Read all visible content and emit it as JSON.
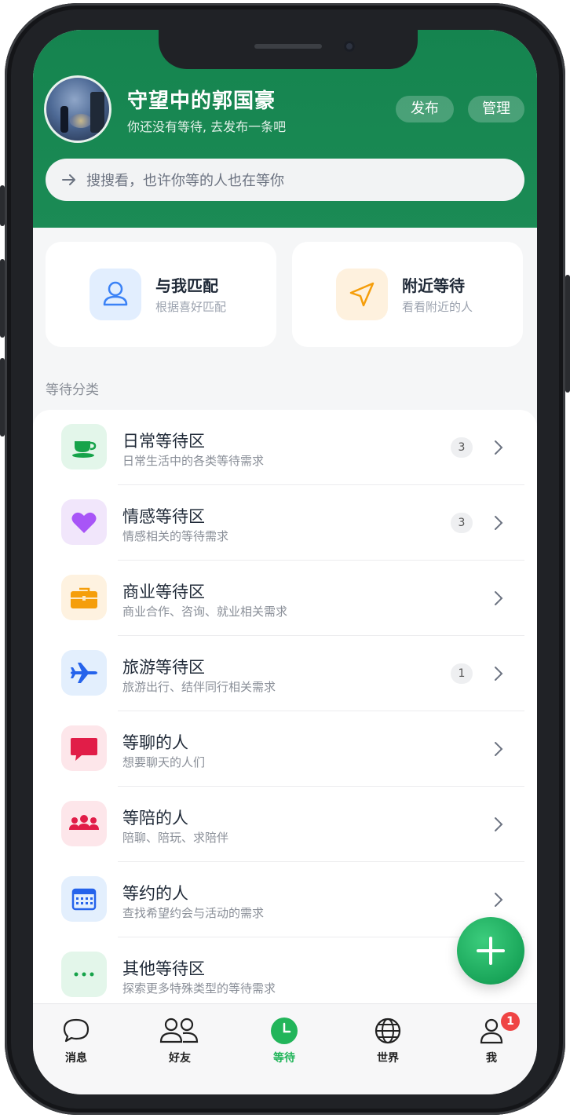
{
  "header": {
    "username": "守望中的郭国豪",
    "subtitle": "你还没有等待, 去发布一条吧",
    "publish_label": "发布",
    "manage_label": "管理",
    "search_placeholder": "搜搜看，也许你等的人也在等你"
  },
  "quick_cards": [
    {
      "title": "与我匹配",
      "subtitle": "根据喜好匹配",
      "icon": "user-icon",
      "icon_color": "#3b82f6"
    },
    {
      "title": "附近等待",
      "subtitle": "看看附近的人",
      "icon": "navigation-icon",
      "icon_color": "#f59e0b"
    }
  ],
  "section_label": "等待分类",
  "categories": [
    {
      "title": "日常等待区",
      "subtitle": "日常生活中的各类等待需求",
      "count": "3",
      "icon": "coffee-cup-icon"
    },
    {
      "title": "情感等待区",
      "subtitle": "情感相关的等待需求",
      "count": "3",
      "icon": "heart-icon"
    },
    {
      "title": "商业等待区",
      "subtitle": "商业合作、咨询、就业相关需求",
      "count": "",
      "icon": "briefcase-icon"
    },
    {
      "title": "旅游等待区",
      "subtitle": "旅游出行、结伴同行相关需求",
      "count": "1",
      "icon": "airplane-icon"
    },
    {
      "title": "等聊的人",
      "subtitle": "想要聊天的人们",
      "count": "",
      "icon": "chat-bubble-icon"
    },
    {
      "title": "等陪的人",
      "subtitle": "陪聊、陪玩、求陪伴",
      "count": "",
      "icon": "group-icon"
    },
    {
      "title": "等约的人",
      "subtitle": "查找希望约会与活动的需求",
      "count": "",
      "icon": "calendar-icon"
    },
    {
      "title": "其他等待区",
      "subtitle": "探索更多特殊类型的等待需求",
      "count": "",
      "icon": "more-dots-icon"
    }
  ],
  "tabbar": [
    {
      "label": "消息",
      "icon": "message-icon"
    },
    {
      "label": "好友",
      "icon": "friends-icon"
    },
    {
      "label": "等待",
      "icon": "clock-icon",
      "active": true
    },
    {
      "label": "世界",
      "icon": "globe-icon"
    },
    {
      "label": "我",
      "icon": "profile-icon",
      "badge": "1"
    }
  ],
  "colors": {
    "brand_green": "#168a50",
    "active_tab": "#22b55a",
    "badge_red": "#ef4444"
  }
}
